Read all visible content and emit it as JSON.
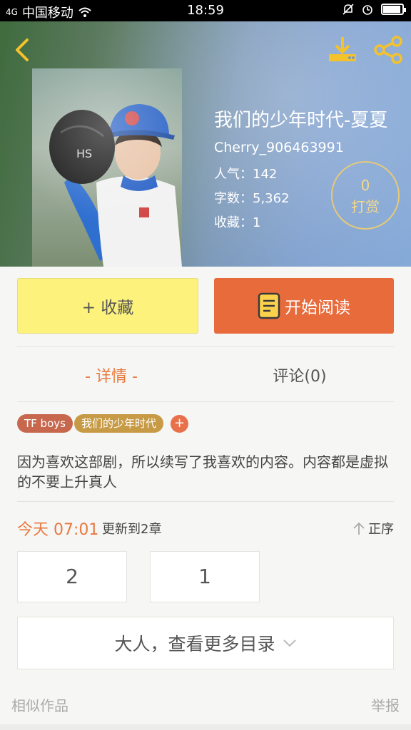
{
  "status_bar": {
    "signal_label": "4G",
    "carrier": "中国移动",
    "time": "18:59"
  },
  "book": {
    "title": "我们的少年时代-夏夏",
    "author": "Cherry_906463991",
    "popularity": "人气：142",
    "word_count": "字数：5,362",
    "favorites": "收藏：1",
    "reward_count": "0",
    "reward_label": "打赏"
  },
  "actions": {
    "collect_label": "+ 收藏",
    "read_label": "开始阅读"
  },
  "tabs": [
    {
      "label": "- 详情 -"
    },
    {
      "label": "评论(0)"
    }
  ],
  "tags": [
    {
      "label": "TF boys"
    },
    {
      "label": "我们的少年时代"
    }
  ],
  "tag_add": "+",
  "description": "因为喜欢这部剧，所以续写了我喜欢的内容。内容都是虚拟的不要上升真人",
  "update": {
    "time": "今天 07:01",
    "text": "更新到2章",
    "order_label": "正序"
  },
  "chapters": [
    {
      "label": "2"
    },
    {
      "label": "1"
    }
  ],
  "more_catalog": "大人，查看更多目录",
  "footer": {
    "similar": "相似作品",
    "report": "举报"
  },
  "colors": {
    "accent": "#e8793f",
    "collect_bg": "#fdf27c",
    "read_bg": "#e86b3c",
    "reward_ring": "#e6c979"
  }
}
